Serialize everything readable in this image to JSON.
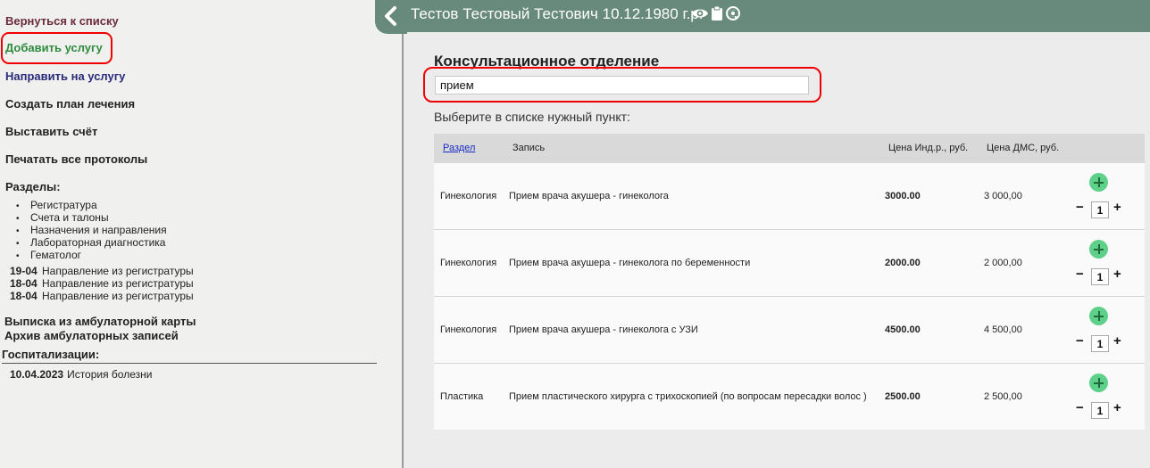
{
  "sidebar": {
    "back": "Вернуться к списку",
    "add_service": "Добавить услугу",
    "direct_service": "Направить на услугу",
    "create_plan": "Создать план лечения",
    "invoice": "Выставить счёт",
    "print_protocols": "Печатать все протоколы",
    "sections_title": "Разделы:",
    "sections": [
      "Регистратура",
      "Счета и талоны",
      "Назначения и направления",
      "Лабораторная диагностика",
      "Гематолог"
    ],
    "directions": [
      {
        "date": "19-04",
        "text": "Направление из регистратуры"
      },
      {
        "date": "18-04",
        "text": "Направление из регистратуры"
      },
      {
        "date": "18-04",
        "text": "Направление из регистратуры"
      }
    ],
    "extract": "Выписка из амбулаторной карты",
    "archive": "Архив амбулаторных записей",
    "hosp_title": "Госпитализации:",
    "hosp_date": "10.04.2023",
    "hosp_text": "История болезни"
  },
  "header": {
    "patient": "Тестов Тестовый Тестович 10.12.1980 г.р.",
    "icons": [
      "eye-icon",
      "clipboard-icon",
      "at-icon"
    ],
    "bg_color": "#678a7c"
  },
  "main": {
    "department": "Консультационное отделение",
    "search_value": "прием",
    "choose_label": "Выберите в списке нужный пункт:",
    "headers": {
      "section": "Раздел",
      "record": "Запись",
      "price_ind": "Цена Инд.р., руб.",
      "price_dms": "Цена ДМС, руб."
    },
    "rows": [
      {
        "section": "Гинекология",
        "record": "Прием врача акушера - гинеколога",
        "price_ind": "3000.00",
        "price_dms": "3 000,00",
        "qty": "1"
      },
      {
        "section": "Гинекология",
        "record": "Прием врача акушера - гинеколога по беременности",
        "price_ind": "2000.00",
        "price_dms": "2 000,00",
        "qty": "1"
      },
      {
        "section": "Гинекология",
        "record": "Прием врача акушера - гинеколога с УЗИ",
        "price_ind": "4500.00",
        "price_dms": "4 500,00",
        "qty": "1"
      },
      {
        "section": "Пластика",
        "record": "Прием пластического хирурга с трихоскопией (по вопросам пересадки волос )",
        "price_ind": "2500.00",
        "price_dms": "2 500,00",
        "qty": "1"
      }
    ],
    "qty_minus": "−",
    "qty_plus": "+"
  },
  "colors": {
    "accent_green": "#2e8b3e",
    "highlight_red": "#e00000",
    "add_button": "#5fd08a"
  }
}
